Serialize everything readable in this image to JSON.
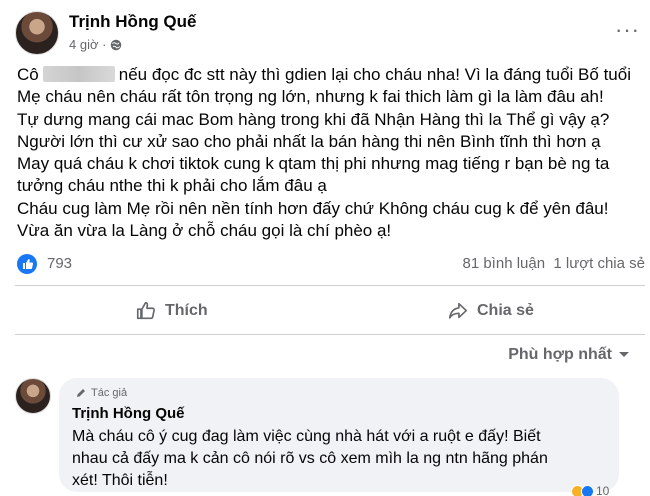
{
  "post": {
    "author": "Trịnh Hồng Quế",
    "time": "4 giờ ·",
    "more": "···",
    "lines": [
      {
        "before": "Cô",
        "after": "nếu đọc đc stt này thì gdien lại cho cháu nha! Vì la đáng tuổi Bố tuổi"
      },
      "Mẹ cháu nên cháu rất tôn trọng ng lớn, nhưng k fai thich làm gì la làm đâu ah!",
      "Tự dưng mang cái mac Bom hàng trong khi đã Nhận Hàng thì la Thể gì vậy ạ?",
      "Người lớn thì cư xử sao cho phải nhất la bán hàng thi nên Bình tĩnh thì hơn ạ",
      "May quá cháu k chơi tiktok cung k qtam thị phi nhưng mag tiếng r bạn bè ng ta",
      "tưởng cháu nthe thi k phải cho lắm đâu ạ",
      "Cháu cug làm Mẹ rồi nên nền tính hơn đấy chứ Không cháu cug k để yên đâu!",
      "Vừa ăn vừa la Làng ở chỗ cháu gọi là chí phèo ạ!"
    ],
    "reaction_count": "793",
    "comments_count": "81 bình luận",
    "shares_count": "1 lượt chia sẻ"
  },
  "actions": {
    "like_label": "Thích",
    "share_label": "Chia sẻ"
  },
  "sort": {
    "label": "Phù hợp nhất"
  },
  "comment": {
    "badge": "Tác giả",
    "author": "Trịnh Hồng Quế",
    "lines": [
      "Mà cháu cô ý cug đag làm việc cùng nhà hát với a ruột e đấy! Biết",
      "nhau cả đấy ma k cản cô nói rõ vs cô xem mìh la ng ntn hãng phán",
      "xét! Thôi tiễn!"
    ],
    "reaction_count": "10"
  },
  "colors": {
    "accent": "#1877f2",
    "secondary_text": "#65676b",
    "bubble_bg": "#f0f2f5",
    "divider": "#ced0d4"
  },
  "icons": {
    "privacy": "globe-icon",
    "like_reaction": "thumbs-up-icon",
    "like_action": "thumbs-up-outline-icon",
    "share_action": "share-arrow-icon",
    "sort": "caret-down-icon",
    "author_badge": "pencil-icon"
  }
}
